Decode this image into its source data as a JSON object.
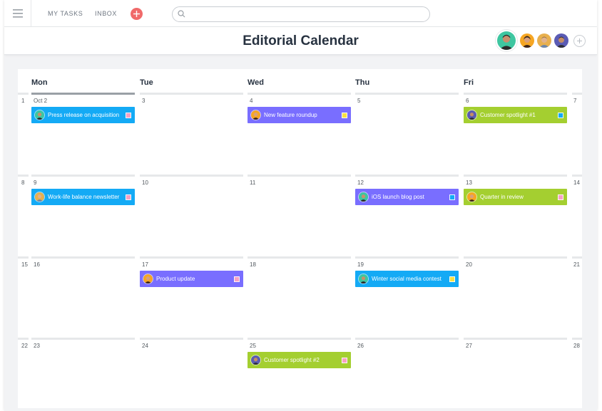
{
  "topbar": {
    "menu_icon": "hamburger-icon",
    "my_tasks": "MY TASKS",
    "inbox": "INBOX",
    "add_icon": "plus-icon",
    "search": {
      "placeholder": "",
      "value": "",
      "icon": "search-icon"
    }
  },
  "header": {
    "title": "Editorial Calendar",
    "add_member_icon": "plus-icon"
  },
  "colors": {
    "blue": "#14aaf5",
    "purple": "#796eff",
    "green": "#a4cf30",
    "tag_pink": "#f7a1c4",
    "tag_yellow": "#f8df43",
    "tag_blue": "#14aaf5",
    "add_button": "#f06a6a"
  },
  "calendar": {
    "days": [
      "Mon",
      "Tue",
      "Wed",
      "Thu",
      "Fri"
    ],
    "weeks": [
      {
        "sun": "1",
        "dates": [
          "Oct 2",
          "3",
          "4",
          "5",
          "6"
        ],
        "sat": "7"
      },
      {
        "sun": "8",
        "dates": [
          "9",
          "10",
          "11",
          "12",
          "13"
        ],
        "sat": "14"
      },
      {
        "sun": "15",
        "dates": [
          "16",
          "17",
          "18",
          "19",
          "20"
        ],
        "sat": "21"
      },
      {
        "sun": "22",
        "dates": [
          "23",
          "24",
          "25",
          "26",
          "27"
        ],
        "sat": "28"
      }
    ],
    "tasks": [
      {
        "label": "Press release on acquisition",
        "week": 0,
        "day": 0,
        "color": "blue",
        "tag": "tag_pink",
        "avatar": "teal"
      },
      {
        "label": "New feature roundup",
        "week": 0,
        "day": 2,
        "color": "purple",
        "tag": "tag_yellow",
        "avatar": "orange"
      },
      {
        "label": "Customer spotlight #1",
        "week": 0,
        "day": 4,
        "color": "green",
        "tag": "tag_blue",
        "avatar": "purple"
      },
      {
        "label": "Work-life balance newsletter",
        "week": 1,
        "day": 0,
        "color": "blue",
        "tag": "tag_pink",
        "avatar": "yellow"
      },
      {
        "label": "iOS launch blog post",
        "week": 1,
        "day": 3,
        "color": "purple",
        "tag": "tag_blue",
        "avatar": "teal"
      },
      {
        "label": "Quarter in review",
        "week": 1,
        "day": 4,
        "color": "green",
        "tag": "tag_pink",
        "avatar": "orange"
      },
      {
        "label": "Product update",
        "week": 2,
        "day": 1,
        "color": "purple",
        "tag": "tag_pink",
        "avatar": "orange"
      },
      {
        "label": "Winter social media contest",
        "week": 2,
        "day": 3,
        "color": "blue",
        "tag": "tag_yellow",
        "avatar": "teal"
      },
      {
        "label": "Customer spotlight #2",
        "week": 3,
        "day": 2,
        "color": "green",
        "tag": "tag_pink",
        "avatar": "purple"
      }
    ]
  }
}
